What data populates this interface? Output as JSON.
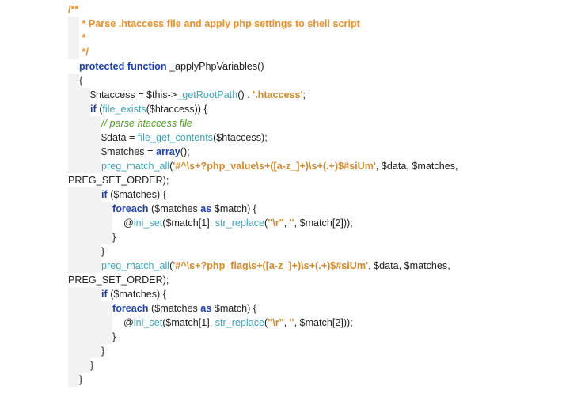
{
  "code": {
    "lines": [
      {
        "indent": 0,
        "guide": 0,
        "tokens": [
          {
            "type": "comment",
            "text": "/**"
          }
        ]
      },
      {
        "indent": 1,
        "guide": 1,
        "tokens": [
          {
            "type": "comment",
            "text": " * Parse .htaccess file and apply php settings to shell script"
          }
        ]
      },
      {
        "indent": 1,
        "guide": 1,
        "tokens": [
          {
            "type": "comment",
            "text": " *"
          }
        ]
      },
      {
        "indent": 1,
        "guide": 1,
        "tokens": [
          {
            "type": "comment",
            "text": " */"
          }
        ]
      },
      {
        "indent": 1,
        "guide": 0,
        "tokens": [
          {
            "type": "keyword",
            "text": "protected function"
          },
          {
            "type": "plain",
            "text": " _applyPhpVariables()"
          }
        ]
      },
      {
        "indent": 1,
        "guide": 1,
        "tokens": [
          {
            "type": "plain",
            "text": "{"
          }
        ]
      },
      {
        "indent": 2,
        "guide": 2,
        "tokens": [
          {
            "type": "plain",
            "text": "$htaccess = $this->"
          },
          {
            "type": "func",
            "text": "_getRootPath"
          },
          {
            "type": "plain",
            "text": "() . "
          },
          {
            "type": "string",
            "text": "'.htaccess'"
          },
          {
            "type": "plain",
            "text": ";"
          }
        ]
      },
      {
        "indent": 2,
        "guide": 2,
        "tokens": [
          {
            "type": "keyword",
            "text": "if"
          },
          {
            "type": "plain",
            "text": " ("
          },
          {
            "type": "func",
            "text": "file_exists"
          },
          {
            "type": "plain",
            "text": "($htaccess)) {"
          }
        ]
      },
      {
        "indent": 3,
        "guide": 3,
        "tokens": [
          {
            "type": "comment-inline",
            "text": "// parse htaccess file"
          }
        ]
      },
      {
        "indent": 3,
        "guide": 3,
        "tokens": [
          {
            "type": "plain",
            "text": "$data = "
          },
          {
            "type": "func",
            "text": "file_get_contents"
          },
          {
            "type": "plain",
            "text": "($htaccess);"
          }
        ]
      },
      {
        "indent": 3,
        "guide": 3,
        "tokens": [
          {
            "type": "plain",
            "text": "$matches = "
          },
          {
            "type": "keyword",
            "text": "array"
          },
          {
            "type": "plain",
            "text": "();"
          }
        ]
      },
      {
        "indent": 3,
        "guide": 3,
        "tokens": [
          {
            "type": "func",
            "text": "preg_match_all"
          },
          {
            "type": "plain",
            "text": "("
          },
          {
            "type": "string",
            "text": "'#^\\s+?php_value\\s+([a-z_]+)\\s+(.+)$#siUm'"
          },
          {
            "type": "plain",
            "text": ", $data, $matches,"
          }
        ]
      },
      {
        "indent": 0,
        "guide": 0,
        "tokens": [
          {
            "type": "plain",
            "text": "PREG_SET_ORDER);"
          }
        ]
      },
      {
        "indent": 3,
        "guide": 3,
        "tokens": [
          {
            "type": "keyword",
            "text": "if"
          },
          {
            "type": "plain",
            "text": " ($matches) {"
          }
        ]
      },
      {
        "indent": 4,
        "guide": 4,
        "tokens": [
          {
            "type": "keyword",
            "text": "foreach"
          },
          {
            "type": "plain",
            "text": " ($matches "
          },
          {
            "type": "keyword",
            "text": "as"
          },
          {
            "type": "plain",
            "text": " $match) {"
          }
        ]
      },
      {
        "indent": 5,
        "guide": 4,
        "tokens": [
          {
            "type": "plain",
            "text": "@"
          },
          {
            "type": "func",
            "text": "ini_set"
          },
          {
            "type": "plain",
            "text": "($match[1], "
          },
          {
            "type": "func",
            "text": "str_replace"
          },
          {
            "type": "plain",
            "text": "("
          },
          {
            "type": "string",
            "text": "\"\\r\""
          },
          {
            "type": "plain",
            "text": ", "
          },
          {
            "type": "string",
            "text": "''"
          },
          {
            "type": "plain",
            "text": ", $match[2]));"
          }
        ]
      },
      {
        "indent": 4,
        "guide": 4,
        "tokens": [
          {
            "type": "plain",
            "text": "}"
          }
        ]
      },
      {
        "indent": 3,
        "guide": 3,
        "tokens": [
          {
            "type": "plain",
            "text": "}"
          }
        ]
      },
      {
        "indent": 3,
        "guide": 3,
        "tokens": [
          {
            "type": "func",
            "text": "preg_match_all"
          },
          {
            "type": "plain",
            "text": "("
          },
          {
            "type": "string",
            "text": "'#^\\s+?php_flag\\s+([a-z_]+)\\s+(.+)$#siUm'"
          },
          {
            "type": "plain",
            "text": ", $data, $matches,"
          }
        ]
      },
      {
        "indent": 0,
        "guide": 0,
        "tokens": [
          {
            "type": "plain",
            "text": "PREG_SET_ORDER);"
          }
        ]
      },
      {
        "indent": 3,
        "guide": 3,
        "tokens": [
          {
            "type": "keyword",
            "text": "if"
          },
          {
            "type": "plain",
            "text": " ($matches) {"
          }
        ]
      },
      {
        "indent": 4,
        "guide": 4,
        "tokens": [
          {
            "type": "keyword",
            "text": "foreach"
          },
          {
            "type": "plain",
            "text": " ($matches "
          },
          {
            "type": "keyword",
            "text": "as"
          },
          {
            "type": "plain",
            "text": " $match) {"
          }
        ]
      },
      {
        "indent": 5,
        "guide": 4,
        "tokens": [
          {
            "type": "plain",
            "text": "@"
          },
          {
            "type": "func",
            "text": "ini_set"
          },
          {
            "type": "plain",
            "text": "($match[1], "
          },
          {
            "type": "func",
            "text": "str_replace"
          },
          {
            "type": "plain",
            "text": "("
          },
          {
            "type": "string",
            "text": "\"\\r\""
          },
          {
            "type": "plain",
            "text": ", "
          },
          {
            "type": "string",
            "text": "''"
          },
          {
            "type": "plain",
            "text": ", $match[2]));"
          }
        ]
      },
      {
        "indent": 4,
        "guide": 4,
        "tokens": [
          {
            "type": "plain",
            "text": "}"
          }
        ]
      },
      {
        "indent": 3,
        "guide": 3,
        "tokens": [
          {
            "type": "plain",
            "text": "}"
          }
        ]
      },
      {
        "indent": 2,
        "guide": 2,
        "tokens": [
          {
            "type": "plain",
            "text": "}"
          }
        ]
      },
      {
        "indent": 1,
        "guide": 1,
        "tokens": [
          {
            "type": "plain",
            "text": "}"
          }
        ]
      }
    ]
  },
  "colors": {
    "comment": "#e8902a",
    "comment_inline": "#4e9a23",
    "keyword": "#1a3fb0",
    "function": "#3aa4b8",
    "string": "#d4892a",
    "plain": "#222222",
    "guide": "#f2f2f2"
  }
}
